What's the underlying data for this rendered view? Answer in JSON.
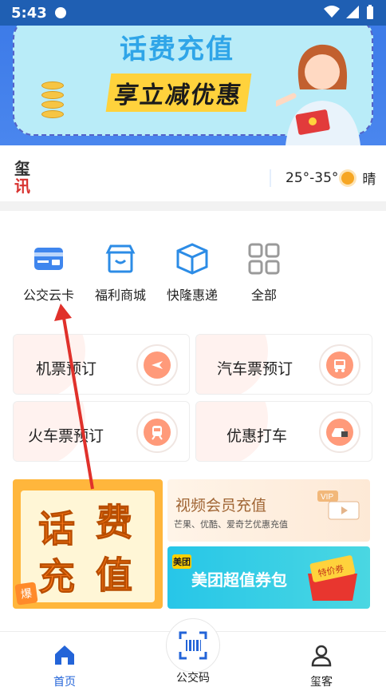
{
  "status_bar": {
    "time": "5:43"
  },
  "banner": {
    "title": "话费充值",
    "subtitle": "享立减优惠"
  },
  "news": {
    "logo_top": "玺",
    "logo_bottom": "讯",
    "temperature": "25°-35°",
    "condition": "晴"
  },
  "menu": [
    {
      "label": "公交云卡",
      "icon": "bus-card-icon"
    },
    {
      "label": "福利商城",
      "icon": "shop-icon"
    },
    {
      "label": "快隆惠递",
      "icon": "package-icon"
    },
    {
      "label": "全部",
      "icon": "grid-icon"
    }
  ],
  "services": [
    {
      "label": "机票预订",
      "icon": "plane-ticket-icon"
    },
    {
      "label": "汽车票预订",
      "icon": "bus-icon"
    },
    {
      "label": "火车票预订",
      "icon": "train-icon"
    },
    {
      "label": "优惠打车",
      "icon": "taxi-icon"
    }
  ],
  "promos": {
    "phone": {
      "c1": "话",
      "c2": "费",
      "c3": "充",
      "c4": "值",
      "tag": "爆"
    },
    "vip": {
      "title": "视频会员充值",
      "subtitle": "芒果、优酷、爱奇艺优惠充值",
      "badge": "VIP"
    },
    "meituan": {
      "badge": "美团",
      "title": "美团超值券包",
      "coupon": "特价券"
    }
  },
  "tabbar": {
    "home": "首页",
    "code": "公交码",
    "profile": "玺客"
  },
  "colors": {
    "primary": "#2364d8",
    "banner": "#3d7be8",
    "accent": "#ff7a1a",
    "arrow": "#e0312b"
  }
}
